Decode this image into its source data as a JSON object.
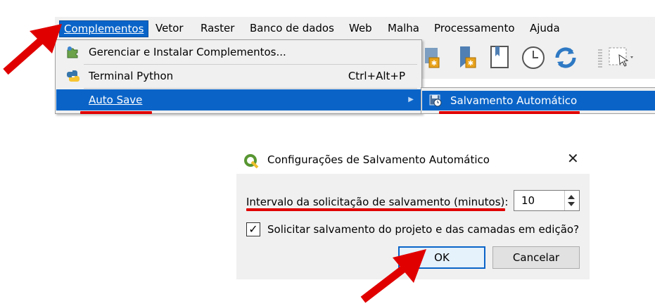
{
  "menubar": {
    "items": [
      {
        "label": "Complementos",
        "active": true
      },
      {
        "label": "Vetor"
      },
      {
        "label": "Raster"
      },
      {
        "label": "Banco de dados"
      },
      {
        "label": "Web"
      },
      {
        "label": "Malha"
      },
      {
        "label": "Processamento"
      },
      {
        "label": "Ajuda"
      }
    ]
  },
  "dropdown": {
    "items": [
      {
        "label": "Gerenciar e Instalar Complementos...",
        "icon": "puzzle-icon"
      },
      {
        "label": "Terminal Python",
        "shortcut": "Ctrl+Alt+P",
        "icon": "python-icon"
      },
      {
        "label": "Auto Save",
        "highlighted": true,
        "has_submenu": true
      }
    ]
  },
  "submenu": {
    "items": [
      {
        "label": "Salvamento Automático",
        "icon": "save-timer-icon",
        "highlighted": true
      }
    ]
  },
  "dialog": {
    "title": "Configurações de Salvamento Automático",
    "interval_label": "Intervalo da solicitação de salvamento (minutos):",
    "interval_value": "10",
    "checkbox_label": "Solicitar salvamento do projeto e das camadas em edição?",
    "checkbox_checked": true,
    "checkbox_mark": "✓",
    "close_glyph": "✕",
    "ok_label": "OK",
    "cancel_label": "Cancelar"
  },
  "colors": {
    "highlight": "#0a64c8",
    "annotation": "#e00000",
    "qgis_green": "#589632"
  }
}
